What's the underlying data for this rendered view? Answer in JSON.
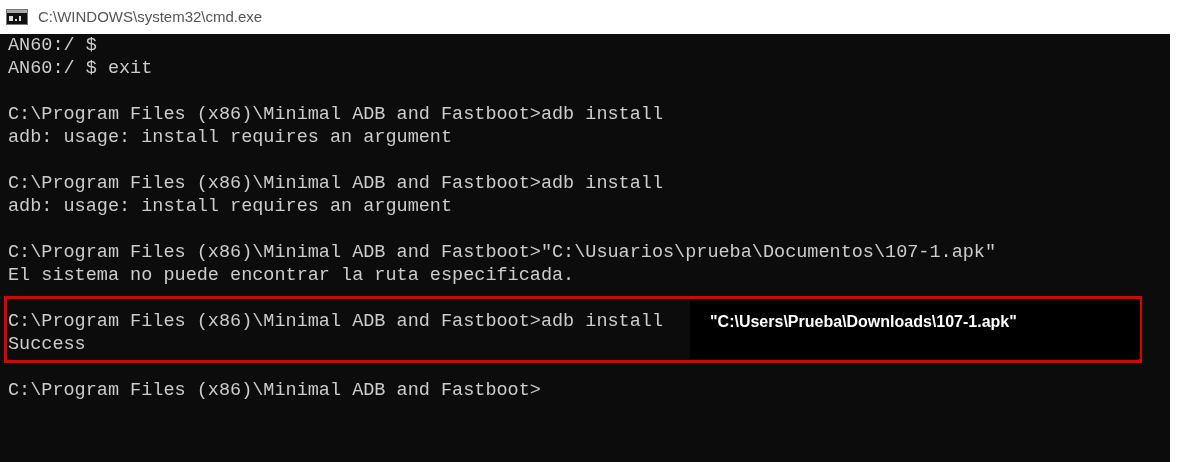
{
  "window": {
    "title": "C:\\WINDOWS\\system32\\cmd.exe"
  },
  "blocks": [
    {
      "highlighted": false,
      "lines": [
        "AN60:/ $",
        "AN60:/ $ exit"
      ]
    },
    {
      "highlighted": false,
      "lines": [
        "C:\\Program Files (x86)\\Minimal ADB and Fastboot>adb install",
        "adb: usage: install requires an argument"
      ]
    },
    {
      "highlighted": false,
      "lines": [
        "C:\\Program Files (x86)\\Minimal ADB and Fastboot>adb install",
        "adb: usage: install requires an argument"
      ]
    },
    {
      "highlighted": false,
      "lines": [
        "C:\\Program Files (x86)\\Minimal ADB and Fastboot>\"C:\\Usuarios\\prueba\\Documentos\\107-1.apk\"",
        "El sistema no puede encontrar la ruta especificada."
      ]
    },
    {
      "highlighted": true,
      "lines": [
        "C:\\Program Files (x86)\\Minimal ADB and Fastboot>adb install",
        "Success"
      ],
      "annotation": "\"C:\\Users\\Prueba\\Downloads\\107-1.apk\""
    },
    {
      "highlighted": false,
      "lines": [
        "C:\\Program Files (x86)\\Minimal ADB and Fastboot>"
      ]
    }
  ]
}
